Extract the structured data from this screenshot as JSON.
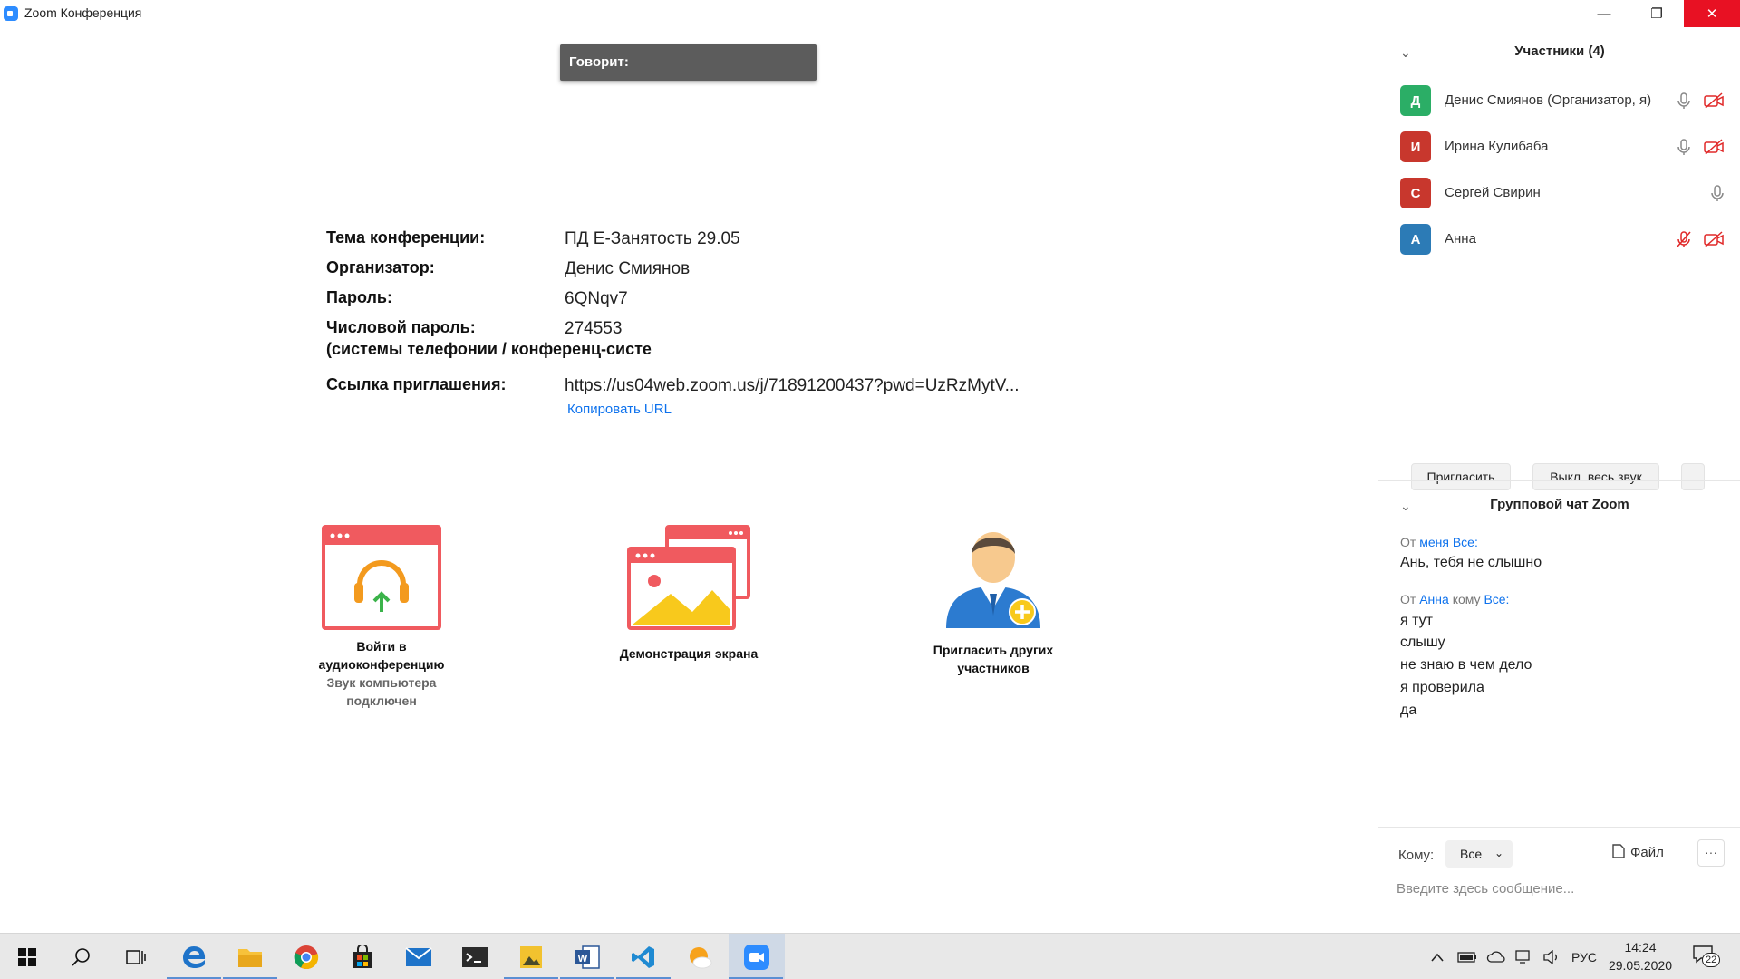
{
  "window": {
    "title": "Zoom Конференция",
    "min": "—",
    "restore": "❐",
    "close": "✕"
  },
  "speaking": {
    "label": "Говорит:"
  },
  "meeting_info": {
    "topic_label": "Тема конференции:",
    "topic_value": "ПД Е-Занятость 29.05",
    "host_label": "Организатор:",
    "host_value": "Денис Смиянов",
    "password_label": "Пароль:",
    "password_value": "6QNqv7",
    "numeric_label_1": "Числовой пароль:",
    "numeric_label_2": "(системы телефонии / конференц-систе",
    "numeric_value": "274553",
    "invite_label": "Ссылка приглашения:",
    "invite_value": "https://us04web.zoom.us/j/71891200437?pwd=UzRzMytV...",
    "copy_url": "Копировать URL"
  },
  "actions": {
    "audio_label_1": "Войти в",
    "audio_label_2": "аудиоконференцию",
    "audio_status_1": "Звук компьютера",
    "audio_status_2": "подключен",
    "share_label": "Демонстрация экрана",
    "invite_label_1": "Пригласить других",
    "invite_label_2": "участников"
  },
  "participants": {
    "title": "Участники (4)",
    "items": [
      {
        "initial": "Д",
        "name": "Денис Смиянов (Организатор, я)",
        "color": "#2BAE66"
      },
      {
        "initial": "И",
        "name": "Ирина Кулибаба",
        "color": "#C8372D"
      },
      {
        "initial": "С",
        "name": "Сергей Свирин",
        "color": "#C8372D"
      },
      {
        "initial": "А",
        "name": "Анна",
        "color": "#2C7BB6"
      }
    ],
    "invite_button": "Пригласить",
    "mute_all_button": "Выкл. весь звук",
    "more_button": "..."
  },
  "chat": {
    "title": "Групповой чат Zoom",
    "msg1_from": "От",
    "msg1_sender": "меня",
    "msg1_to": "Все:",
    "msg1_text": "Ань, тебя не слышно",
    "msg2_from": "От",
    "msg2_sender": "Анна",
    "msg2_mid": "кому",
    "msg2_to": "Все:",
    "msg2_lines": [
      "я тут",
      "слышу",
      "не знаю в чем дело",
      "я проверила",
      "да"
    ],
    "to_label": "Кому:",
    "to_value": "Все",
    "file_button": "Файл",
    "more": "···",
    "placeholder": "Введите здесь сообщение..."
  },
  "taskbar": {
    "language": "РУС",
    "time": "14:24",
    "date": "29.05.2020",
    "notifications": "22"
  }
}
